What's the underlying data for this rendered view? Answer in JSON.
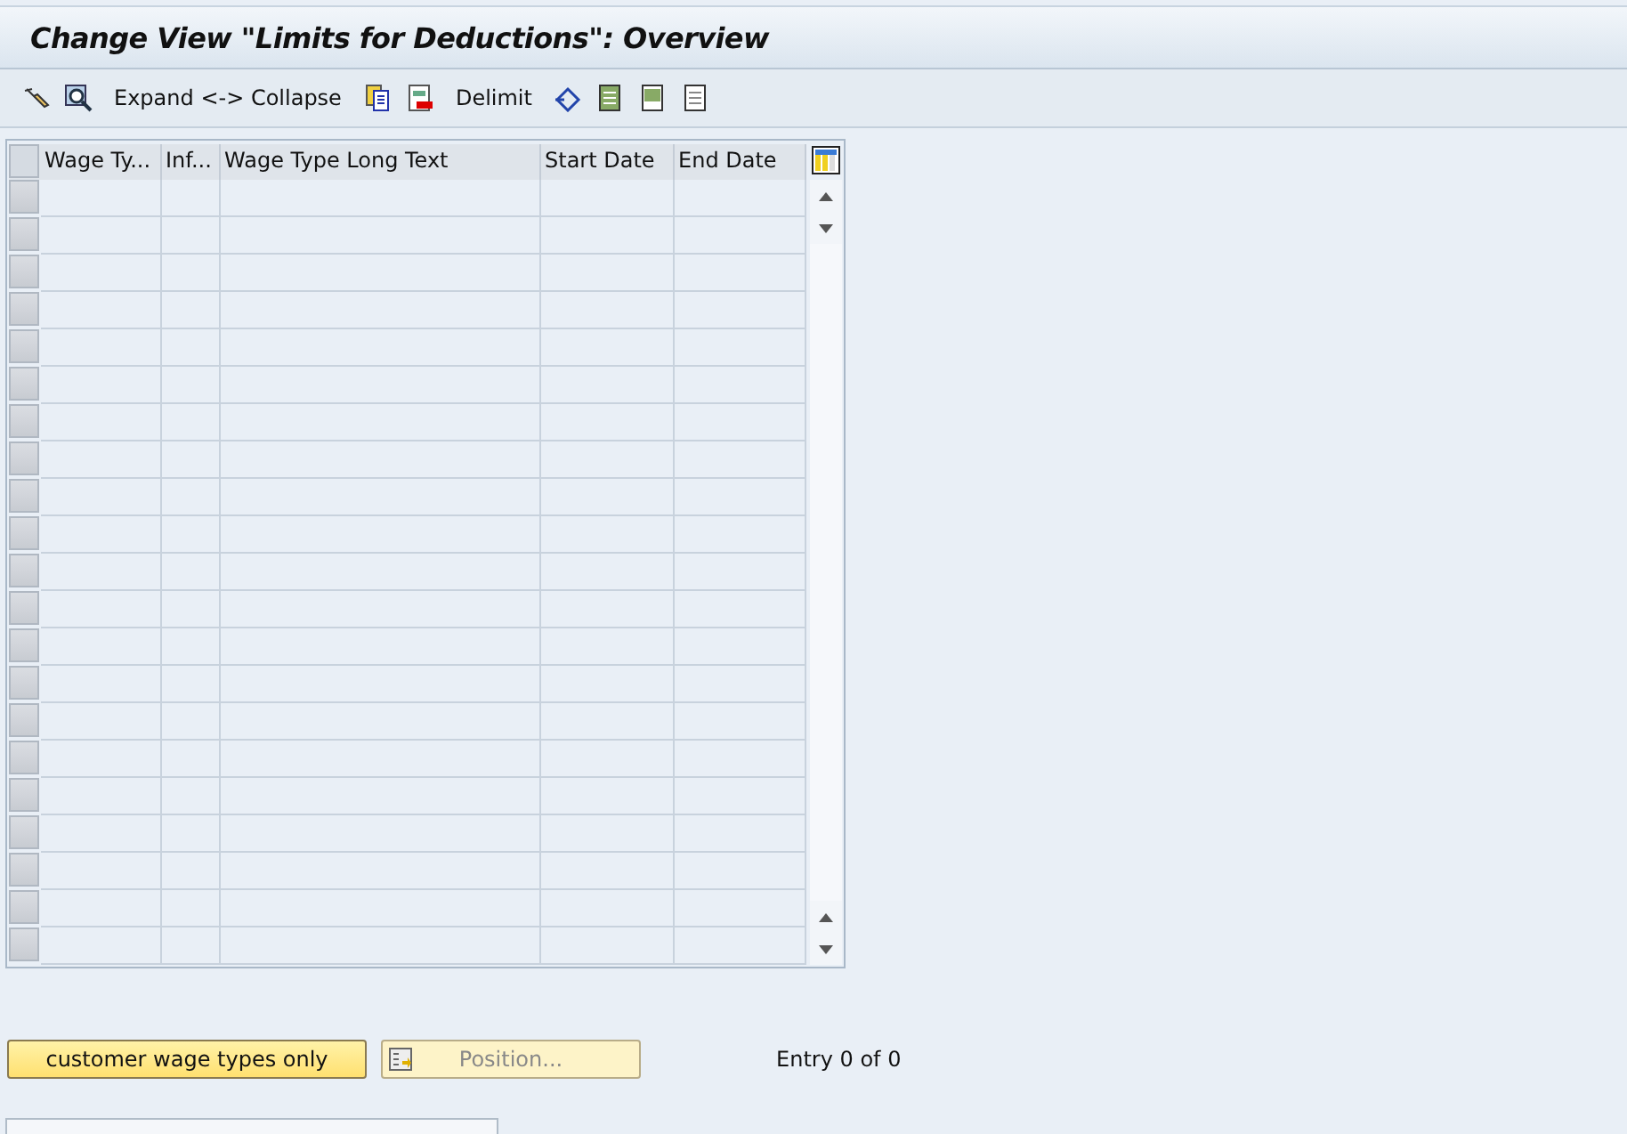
{
  "window": {
    "title": "Change View \"Limits for Deductions\": Overview"
  },
  "toolbar": {
    "buttons": [
      "Expand <-> Collapse",
      "Delimit"
    ]
  },
  "table": {
    "columns": [
      "Wage Ty...",
      "Inf...",
      "Wage Type Long Text",
      "Start Date",
      "End Date"
    ]
  },
  "footer": {
    "buttons": [
      {
        "label": "customer wage types only",
        "disabled": false
      },
      {
        "label": "Position...",
        "disabled": true
      }
    ],
    "entry_info": "Entry 0 of 0"
  }
}
